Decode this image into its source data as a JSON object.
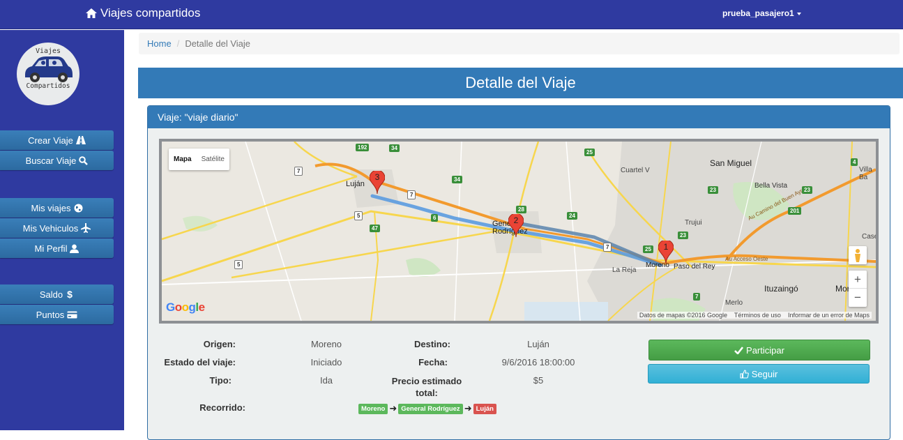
{
  "navbar": {
    "brand": "Viajes compartidos",
    "user": "prueba_pasajero1"
  },
  "logo": {
    "line1": "Viajes",
    "line2": "Compartidos"
  },
  "sidebar": {
    "group1": [
      {
        "label": "Crear Viaje",
        "icon": "road-icon"
      },
      {
        "label": "Buscar Viaje",
        "icon": "search-icon"
      }
    ],
    "group2": [
      {
        "label": "Mis viajes",
        "icon": "globe-icon"
      },
      {
        "label": "Mis Vehiculos",
        "icon": "plane-icon"
      },
      {
        "label": "Mi Perfil",
        "icon": "user-icon"
      }
    ],
    "group3": [
      {
        "label": "Saldo",
        "icon": "dollar-icon"
      },
      {
        "label": "Puntos",
        "icon": "credit-card-icon"
      }
    ]
  },
  "breadcrumb": {
    "home": "Home",
    "current": "Detalle del Viaje"
  },
  "page_title": "Detalle del Viaje",
  "panel": {
    "heading": "Viaje: \"viaje diario\""
  },
  "map": {
    "type_map": "Mapa",
    "type_satellite": "Satélite",
    "credit_data": "Datos de mapas ©2016 Google",
    "credit_terms": "Términos de uso",
    "credit_report": "Informar de un error de Maps",
    "logo": "Google",
    "places": [
      "Luján",
      "General Rodríguez",
      "Moreno",
      "San Miguel",
      "Bella Vista",
      "Cuartel V",
      "Trujui",
      "Paso del Rey",
      "La Reja",
      "Ituzaingó",
      "Morón",
      "Merlo",
      "Villa Ba",
      "Case",
      "Au Camino del Buen Ayre",
      "Au Acceso Oeste"
    ],
    "markers": [
      "1",
      "2",
      "3"
    ],
    "route_shields": [
      "192",
      "34",
      "7",
      "7",
      "34",
      "25",
      "28",
      "24",
      "6",
      "5",
      "47",
      "5",
      "7",
      "25",
      "23",
      "23",
      "23",
      "201",
      "4",
      "4",
      "7"
    ],
    "zoom_in": "+",
    "zoom_out": "−"
  },
  "details": {
    "origen_label": "Origen:",
    "origen_value": "Moreno",
    "destino_label": "Destino:",
    "destino_value": "Luján",
    "estado_label": "Estado del viaje:",
    "estado_value": "Iniciado",
    "fecha_label": "Fecha:",
    "fecha_value": "9/6/2016 18:00:00",
    "tipo_label": "Tipo:",
    "tipo_value": "Ida",
    "precio_label_1": "Precio estimado",
    "precio_label_2": "total:",
    "precio_value": "$5",
    "recorrido_label": "Recorrido:",
    "recorrido": [
      "Moreno",
      "General Rodríguez",
      "Luján"
    ]
  },
  "actions": {
    "participar": "Participar",
    "seguir": "Seguir"
  },
  "colors": {
    "navbar": "#2f3aa0",
    "primary": "#337ab7",
    "success": "#5cb85c",
    "info": "#5bc0de",
    "danger": "#d9534f"
  }
}
